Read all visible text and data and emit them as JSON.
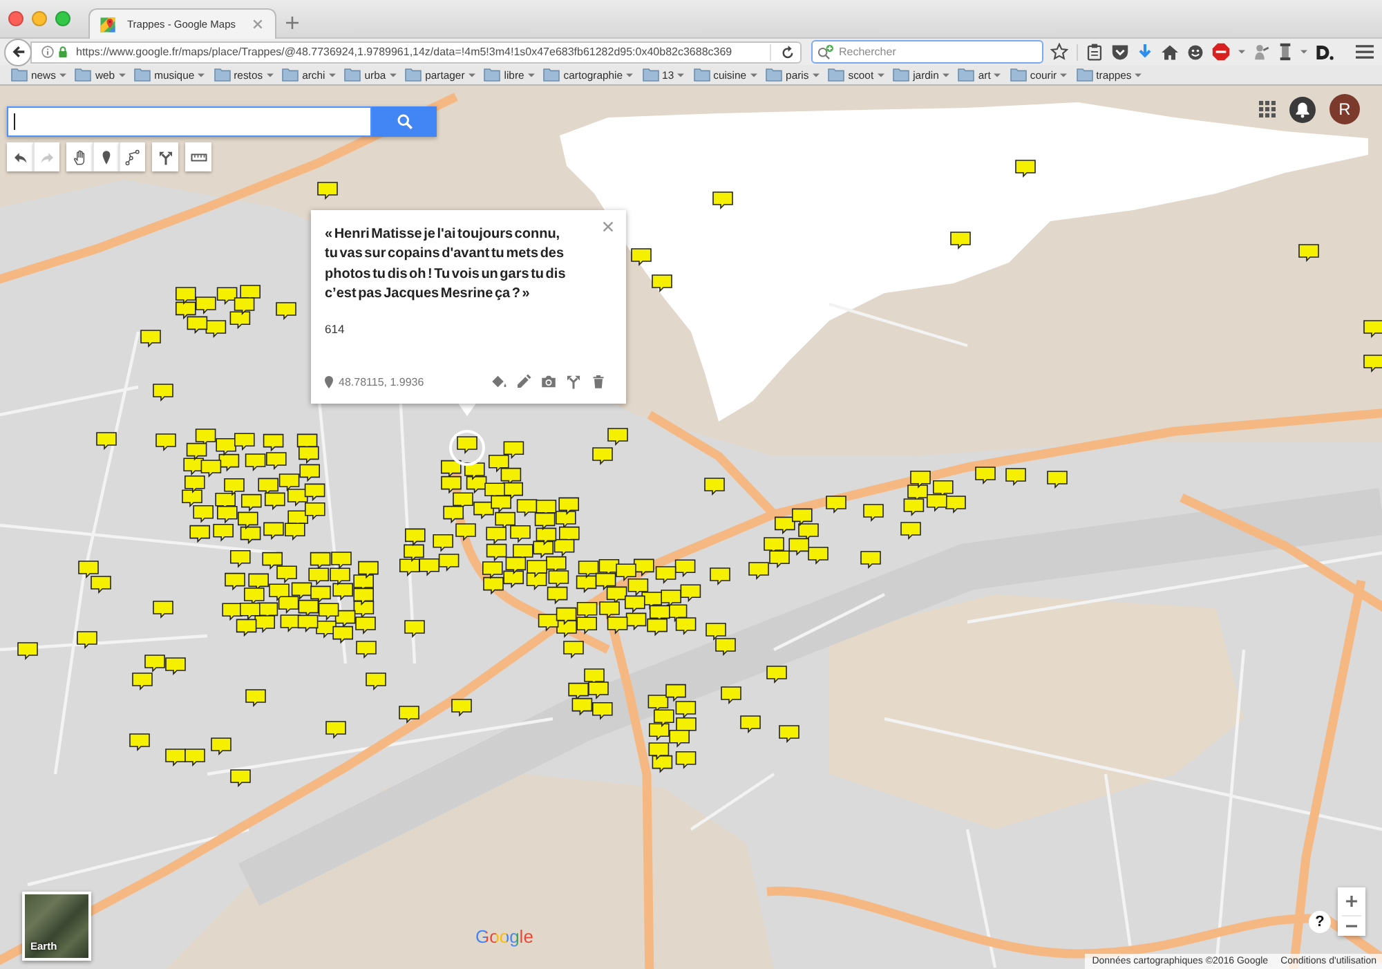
{
  "tabs": [
    {
      "title": "Trappes - Google Maps",
      "selected": true
    }
  ],
  "address_bar": {
    "url": "https://www.google.fr/maps/place/Trappes/@48.7736924,1.9789961,14z/data=!4m5!3m4!1s0x47e683fb61282d95:0x40b82c3688c369"
  },
  "search_bar": {
    "placeholder": "Rechercher"
  },
  "bookmarks": [
    "news",
    "web",
    "musique",
    "restos",
    "archi",
    "urba",
    "partager",
    "libre",
    "cartographie",
    "13",
    "cuisine",
    "paris",
    "scoot",
    "jardin",
    "art",
    "courir",
    "trappes"
  ],
  "map": {
    "toolbar_groups": [
      {
        "tools": [
          {
            "kind": "undo",
            "disabled": false
          },
          {
            "kind": "redo",
            "disabled": true
          }
        ]
      },
      {
        "tools": [
          {
            "kind": "pan",
            "disabled": false
          },
          {
            "kind": "marker",
            "disabled": false
          },
          {
            "kind": "line",
            "disabled": false
          }
        ]
      },
      {
        "tools": [
          {
            "kind": "directions",
            "disabled": false
          }
        ]
      },
      {
        "tools": [
          {
            "kind": "measure",
            "disabled": false
          }
        ]
      }
    ],
    "account": {
      "initial": "R"
    },
    "popup": {
      "title": "« Henri Matisse je l'ai toujours connu, tu vas sur copains d'avant tu mets des photos tu dis oh ! Tu vois un gars tu dis c’est pas Jacques Mesrine ça ? »",
      "description": "614",
      "coordinates": "48.78115, 1.9936",
      "actions": [
        {
          "kind": "style"
        },
        {
          "kind": "edit"
        },
        {
          "kind": "photo"
        },
        {
          "kind": "directions"
        },
        {
          "kind": "delete"
        }
      ]
    },
    "layer_button": {
      "label": "Earth"
    },
    "logo": "Google",
    "help": "?",
    "attribution": {
      "credit": "Données cartographiques ©2016 Google",
      "terms": "Conditions d'utilisation"
    }
  }
}
